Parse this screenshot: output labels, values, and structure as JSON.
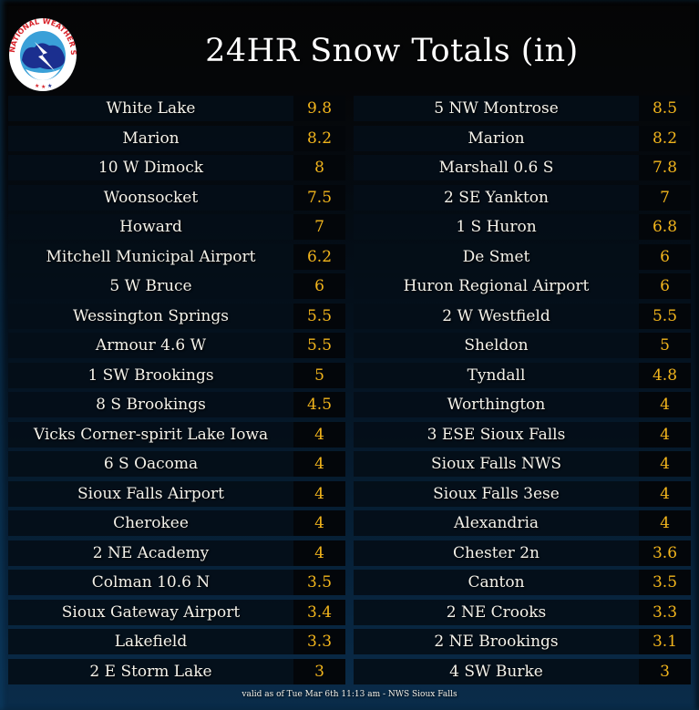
{
  "header": {
    "title": "24HR Snow Totals (in)",
    "logo": "nws-logo-icon",
    "logo_text": "NATIONAL WEATHER SERVICE"
  },
  "colors": {
    "value_text": "#f2b51c",
    "name_text": "#f4f2ea",
    "bg_top": "#050505",
    "bg_bottom": "#0a2c4a"
  },
  "left_column": [
    {
      "name": "White Lake",
      "value": "9.8"
    },
    {
      "name": "Marion",
      "value": "8.2"
    },
    {
      "name": "10 W Dimock",
      "value": "8"
    },
    {
      "name": "Woonsocket",
      "value": "7.5"
    },
    {
      "name": "Howard",
      "value": "7"
    },
    {
      "name": "Mitchell Municipal Airport",
      "value": "6.2"
    },
    {
      "name": "5 W Bruce",
      "value": "6"
    },
    {
      "name": "Wessington Springs",
      "value": "5.5"
    },
    {
      "name": "Armour 4.6 W",
      "value": "5.5"
    },
    {
      "name": "1 SW Brookings",
      "value": "5"
    },
    {
      "name": "8 S Brookings",
      "value": "4.5"
    },
    {
      "name": "Vicks Corner-spirit Lake Iowa",
      "value": "4"
    },
    {
      "name": "6 S Oacoma",
      "value": "4"
    },
    {
      "name": "Sioux Falls Airport",
      "value": "4"
    },
    {
      "name": "Cherokee",
      "value": "4"
    },
    {
      "name": "2 NE Academy",
      "value": "4"
    },
    {
      "name": "Colman 10.6 N",
      "value": "3.5"
    },
    {
      "name": "Sioux Gateway Airport",
      "value": "3.4"
    },
    {
      "name": "Lakefield",
      "value": "3.3"
    },
    {
      "name": "2 E Storm Lake",
      "value": "3"
    }
  ],
  "right_column": [
    {
      "name": "5 NW Montrose",
      "value": "8.5"
    },
    {
      "name": "Marion",
      "value": "8.2"
    },
    {
      "name": "Marshall 0.6 S",
      "value": "7.8"
    },
    {
      "name": "2 SE Yankton",
      "value": "7"
    },
    {
      "name": "1 S Huron",
      "value": "6.8"
    },
    {
      "name": "De Smet",
      "value": "6"
    },
    {
      "name": "Huron Regional Airport",
      "value": "6"
    },
    {
      "name": "2 W Westfield",
      "value": "5.5"
    },
    {
      "name": "Sheldon",
      "value": "5"
    },
    {
      "name": "Tyndall",
      "value": "4.8"
    },
    {
      "name": "Worthington",
      "value": "4"
    },
    {
      "name": "3 ESE Sioux Falls",
      "value": "4"
    },
    {
      "name": "Sioux Falls NWS",
      "value": "4"
    },
    {
      "name": "Sioux Falls 3ese",
      "value": "4"
    },
    {
      "name": "Alexandria",
      "value": "4"
    },
    {
      "name": "Chester 2n",
      "value": "3.6"
    },
    {
      "name": "Canton",
      "value": "3.5"
    },
    {
      "name": "2 NE Crooks",
      "value": "3.3"
    },
    {
      "name": "2 NE Brookings",
      "value": "3.1"
    },
    {
      "name": "4 SW Burke",
      "value": "3"
    }
  ],
  "footer": {
    "text": "valid as of Tue Mar 6th 11:13 am - NWS Sioux Falls"
  }
}
